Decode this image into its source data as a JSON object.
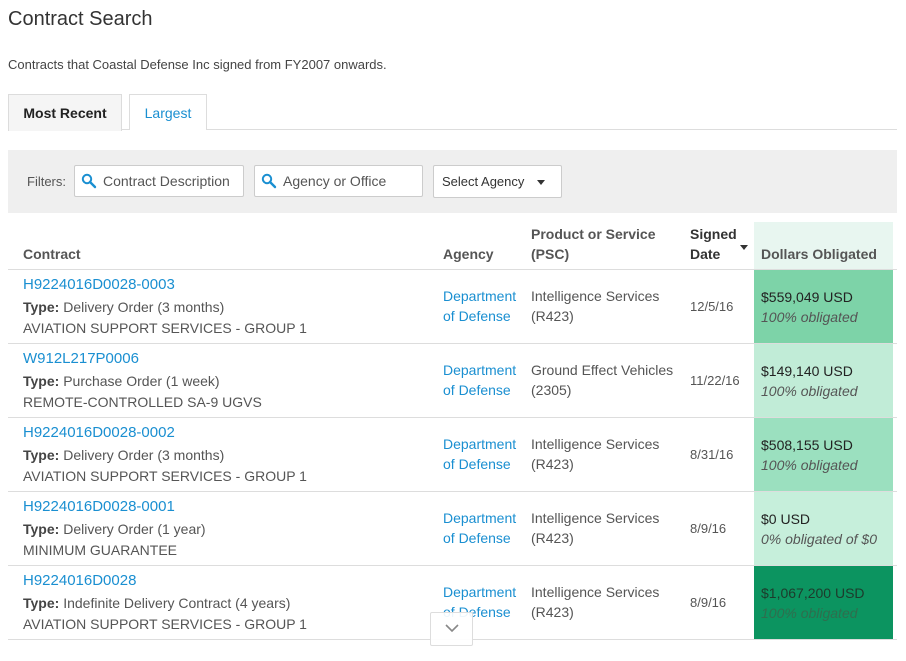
{
  "page": {
    "title": "Contract Search",
    "subtitle": "Contracts that Coastal Defense Inc signed from FY2007 onwards."
  },
  "tabs": [
    {
      "label": "Most Recent",
      "active": true
    },
    {
      "label": "Largest",
      "active": false
    }
  ],
  "filters": {
    "label": "Filters:",
    "description_placeholder": "Contract Description",
    "office_placeholder": "Agency or Office",
    "agency_select": "Select Agency",
    "icons": [
      "search-icon",
      "chevron-down-icon"
    ]
  },
  "table": {
    "headers": {
      "contract": "Contract",
      "agency": "Agency",
      "psc": "Product or Service (PSC)",
      "signed_date": "Signed Date",
      "dollars": "Dollars Obligated"
    },
    "rows": [
      {
        "id": "H9224016D0028-0003",
        "type_label": "Type:",
        "type": "Delivery Order (3 months)",
        "description": "AVIATION SUPPORT SERVICES - GROUP 1",
        "agency": "Department of Defense",
        "psc": "Intelligence Services (R423)",
        "date": "12/5/16",
        "amount": "$559,049 USD",
        "obligated": "100% obligated",
        "color": "#7dd3a8"
      },
      {
        "id": "W912L217P0006",
        "type_label": "Type:",
        "type": "Purchase Order (1 week)",
        "description": "REMOTE-CONTROLLED SA-9 UGVS",
        "agency": "Department of Defense",
        "psc": "Ground Effect Vehicles (2305)",
        "date": "11/22/16",
        "amount": "$149,140 USD",
        "obligated": "100% obligated",
        "color": "#c1ecd7"
      },
      {
        "id": "H9224016D0028-0002",
        "type_label": "Type:",
        "type": "Delivery Order (3 months)",
        "description": "AVIATION SUPPORT SERVICES - GROUP 1",
        "agency": "Department of Defense",
        "psc": "Intelligence Services (R423)",
        "date": "8/31/16",
        "amount": "$508,155 USD",
        "obligated": "100% obligated",
        "color": "#9be0bf"
      },
      {
        "id": "H9224016D0028-0001",
        "type_label": "Type:",
        "type": "Delivery Order (1 year)",
        "description": "MINIMUM GUARANTEE",
        "agency": "Department of Defense",
        "psc": "Intelligence Services (R423)",
        "date": "8/9/16",
        "amount": "$0 USD",
        "obligated": "0% obligated of $0",
        "color": "#c6efdb"
      },
      {
        "id": "H9224016D0028",
        "type_label": "Type:",
        "type": "Indefinite Delivery Contract (4 years)",
        "description": "AVIATION SUPPORT SERVICES - GROUP 1",
        "agency": "Department of Defense",
        "psc": "Intelligence Services (R423)",
        "date": "8/9/16",
        "amount": "$1,067,200 USD",
        "obligated": "100% obligated",
        "color": "#0c9460"
      }
    ]
  },
  "accent_color": "#1a8fd1"
}
